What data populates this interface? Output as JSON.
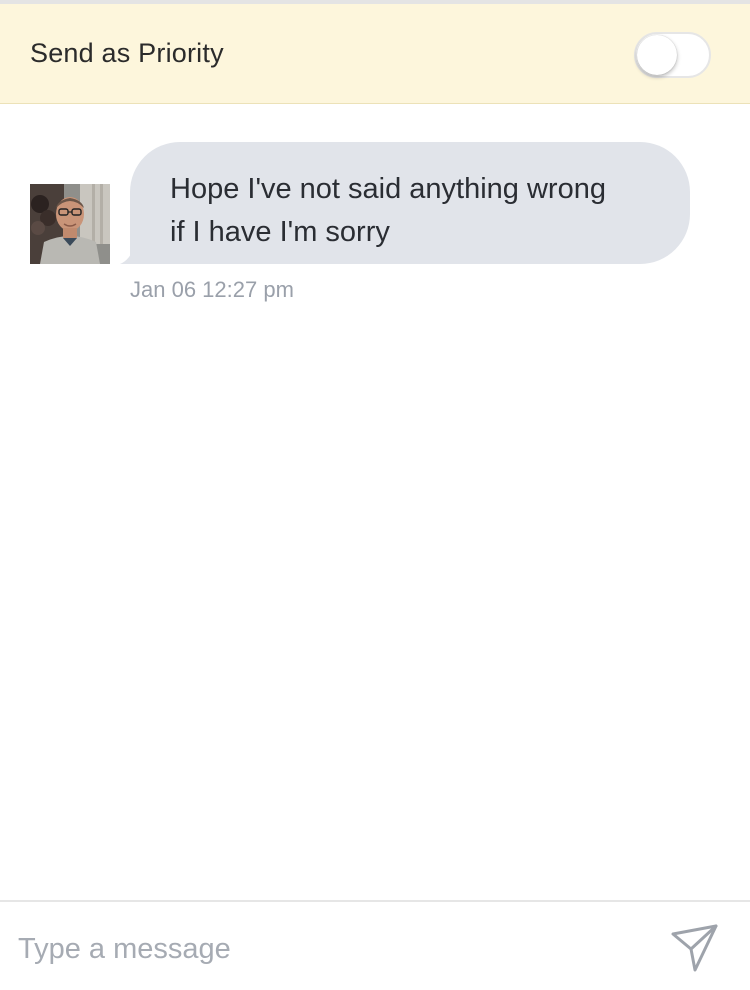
{
  "priority": {
    "label": "Send as Priority",
    "toggle_on": false
  },
  "conversation": {
    "messages": [
      {
        "sender_avatar": "person-photo",
        "text": "Hope I've not said anything wrong\nif I have I'm sorry",
        "timestamp": "Jan 06 12:27 pm"
      }
    ]
  },
  "composer": {
    "placeholder": "Type a message",
    "value": "",
    "send_icon": "send-paper-plane-icon"
  },
  "colors": {
    "priority_bar": "#fdf6dc",
    "bubble": "#e1e4ea",
    "timestamp": "#9aa0aa",
    "icon": "#9ea3ab"
  }
}
